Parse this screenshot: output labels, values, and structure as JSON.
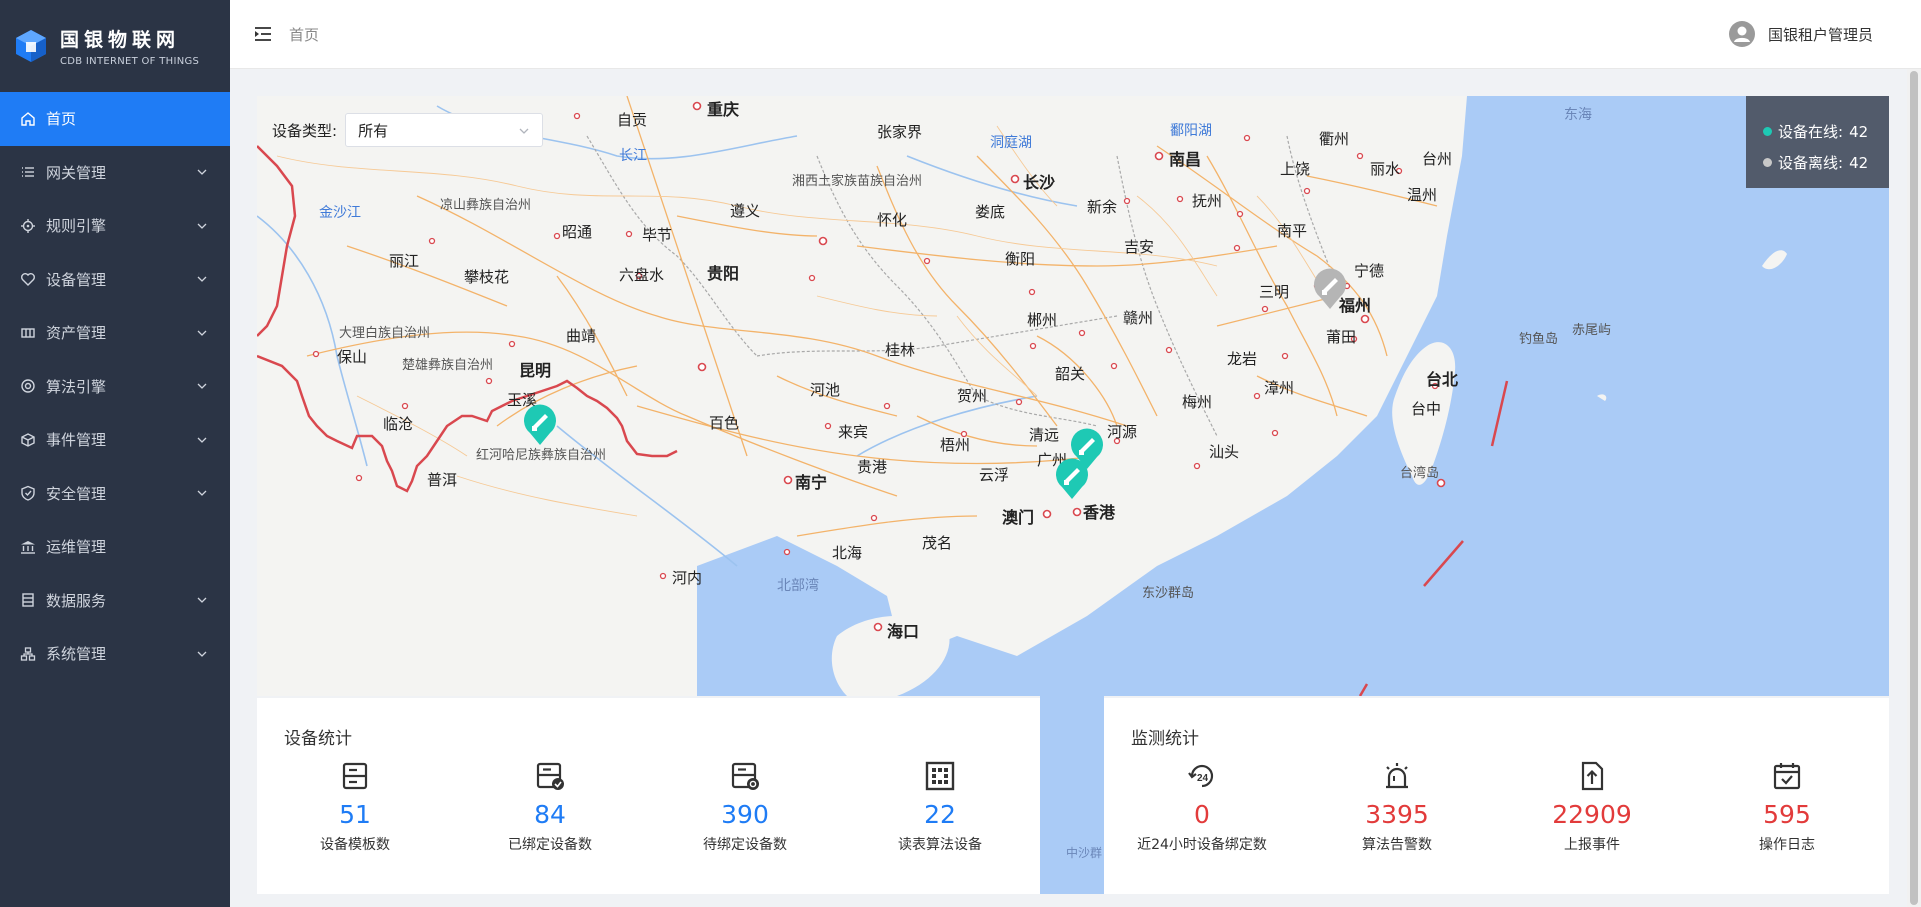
{
  "app": {
    "logo_cn": "国银物联网",
    "logo_en": "CDB INTERNET OF THINGS"
  },
  "sidebar": {
    "items": [
      {
        "label": "首页",
        "icon": "home-icon"
      },
      {
        "label": "网关管理",
        "icon": "list-icon"
      },
      {
        "label": "规则引擎",
        "icon": "target-icon"
      },
      {
        "label": "设备管理",
        "icon": "heart-icon"
      },
      {
        "label": "资产管理",
        "icon": "asset-icon"
      },
      {
        "label": "算法引擎",
        "icon": "engine-icon"
      },
      {
        "label": "事件管理",
        "icon": "cube-icon"
      },
      {
        "label": "安全管理",
        "icon": "shield-icon"
      },
      {
        "label": "运维管理",
        "icon": "bank-icon"
      },
      {
        "label": "数据服务",
        "icon": "database-icon"
      },
      {
        "label": "系统管理",
        "icon": "org-icon"
      }
    ]
  },
  "header": {
    "breadcrumb": "首页",
    "user": "国银租户管理员"
  },
  "map": {
    "filter_label": "设备类型:",
    "filter_value": "所有",
    "online_label": "设备在线:",
    "online_count": "42",
    "offline_label": "设备离线:",
    "offline_count": "42",
    "online_color": "#1ec9b4",
    "offline_color": "#c8c8c8",
    "labels": {
      "chongqing": "重庆",
      "zigong": "自贡",
      "zhangjiajie": "张家界",
      "dongtinghu": "洞庭湖",
      "nanchang": "南昌",
      "poyanghu": "鄱阳湖",
      "shangrao": "上饶",
      "quzhou": "衢州",
      "lishui": "丽水",
      "taizhou": "台州",
      "wenzhou": "温州",
      "donghai": "东海",
      "changjiang": "长江",
      "xiangxi": "湘西土家族苗族自治州",
      "changsha": "长沙",
      "jinshajiang": "金沙江",
      "liangshan": "凉山彝族自治州",
      "zhaotong": "昭通",
      "bijie": "毕节",
      "zunyi": "遵义",
      "huaihua": "怀化",
      "loudi": "娄底",
      "xinyu": "新余",
      "fuzhou_jx": "抚州",
      "nanping": "南平",
      "lijiang": "丽江",
      "panzhihua": "攀枝花",
      "liupanshui": "六盘水",
      "guiyang": "贵阳",
      "hengyang": "衡阳",
      "jian": "吉安",
      "sanming": "三明",
      "ningde": "宁德",
      "fuzhou": "福州",
      "dali": "大理白族自治州",
      "baoshan": "保山",
      "qujing": "曲靖",
      "chuxiong": "楚雄彝族自治州",
      "kunming": "昆明",
      "guilin": "桂林",
      "chenzhou": "郴州",
      "ganzhou": "赣州",
      "putian": "莆田",
      "diaoyudao": "钓鱼岛",
      "chiweiyu": "赤尾屿",
      "longyan": "龙岩",
      "taibei": "台北",
      "yuxi": "玉溪",
      "hechi": "河池",
      "shaoguan": "韶关",
      "zhangzhou": "漳州",
      "hezhou": "贺州",
      "meizhou": "梅州",
      "lincang": "临沧",
      "baise": "百色",
      "laibin": "来宾",
      "qingyuan": "清远",
      "heyuan": "河源",
      "taizhong": "台中",
      "honghe": "红河哈尼族彝族自治州",
      "guigang": "贵港",
      "wuzhou": "梧州",
      "guangzhou": "广州",
      "shantou": "汕头",
      "puer": "普洱",
      "nanning": "南宁",
      "yunfu": "云浮",
      "taiwan_strait": "台湾岛",
      "aomen": "澳门",
      "xianggang": "香港",
      "maoming": "茂名",
      "beihai": "北海",
      "hanoi": "河内",
      "beibuwan": "北部湾",
      "dongsha": "东沙群岛",
      "haikou": "海口",
      "zhongsha": "中沙群"
    }
  },
  "device_stats": {
    "title": "设备统计",
    "items": [
      {
        "value": "51",
        "label": "设备模板数",
        "icon": "template-icon"
      },
      {
        "value": "84",
        "label": "已绑定设备数",
        "icon": "bound-device-icon"
      },
      {
        "value": "390",
        "label": "待绑定设备数",
        "icon": "pending-device-icon"
      },
      {
        "value": "22",
        "label": "读表算法设备",
        "icon": "meter-grid-icon"
      }
    ]
  },
  "monitor_stats": {
    "title": "监测统计",
    "items": [
      {
        "value": "0",
        "label": "近24小时设备绑定数",
        "icon": "24h-icon"
      },
      {
        "value": "3395",
        "label": "算法告警数",
        "icon": "alarm-icon"
      },
      {
        "value": "22909",
        "label": "上报事件",
        "icon": "upload-icon"
      },
      {
        "value": "595",
        "label": "操作日志",
        "icon": "calendar-check-icon"
      }
    ]
  }
}
